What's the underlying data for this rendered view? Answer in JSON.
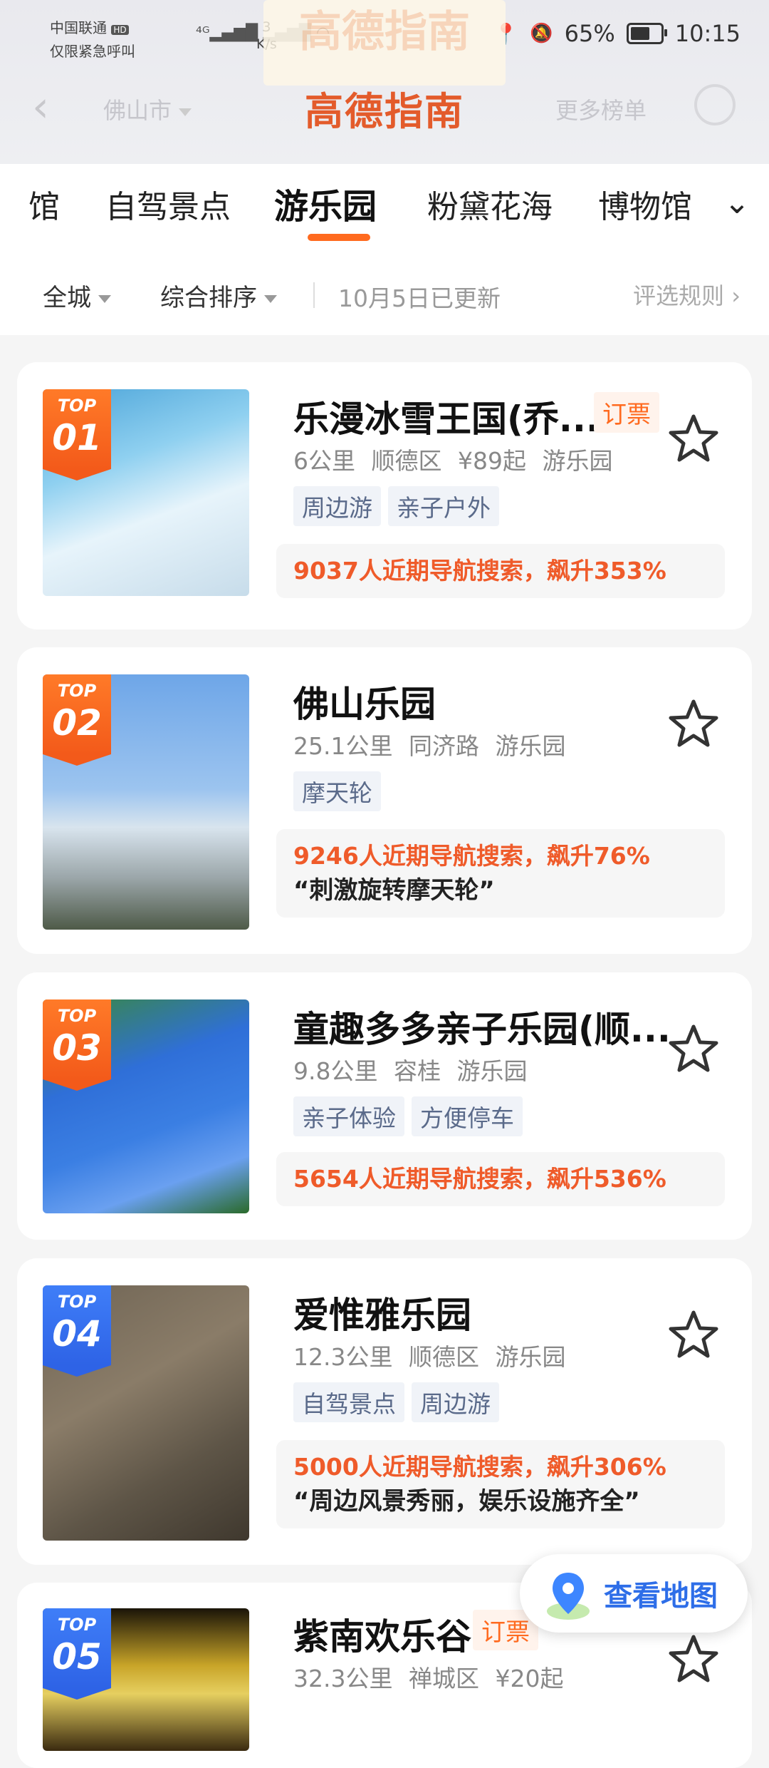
{
  "status_bar": {
    "carrier_line1": "中国联通",
    "carrier_hd": "HD",
    "carrier_line2": "仅限紧急呼叫",
    "net_value": "3",
    "net_unit": "K/s",
    "battery": "65%",
    "battery_level": 0.65,
    "time": "10:15"
  },
  "nav": {
    "city": "佛山市",
    "more": "更多榜单",
    "logo_ghost": "高德指南",
    "logo": "高德指南"
  },
  "tabs": [
    "馆",
    "自驾景点",
    "游乐园",
    "粉黛花海",
    "博物馆"
  ],
  "active_tab_index": 2,
  "filters": {
    "area": "全城",
    "sort": "综合排序",
    "updated": "10月5日已更新",
    "rules": "评选规则"
  },
  "items": [
    {
      "rank_label": "TOP",
      "rank": "01",
      "badge_color": "#f35a1a",
      "title": "乐漫冰雪王国(乔...",
      "ticket": "订票",
      "meta": "6公里  顺德区  ¥89起  游乐园",
      "tags": [
        "周边游",
        "亲子户外"
      ],
      "stat": "9037人近期导航搜索，飙升353%",
      "quote": ""
    },
    {
      "rank_label": "TOP",
      "rank": "02",
      "badge_color": "#f35a1a",
      "title": "佛山乐园",
      "ticket": "",
      "meta": "25.1公里  同济路  游乐园",
      "tags": [
        "摩天轮"
      ],
      "stat": "9246人近期导航搜索，飙升76%",
      "quote": "“刺激旋转摩天轮”"
    },
    {
      "rank_label": "TOP",
      "rank": "03",
      "badge_color": "#f35a1a",
      "title": "童趣多多亲子乐园(顺...",
      "ticket": "",
      "meta": "9.8公里  容桂  游乐园",
      "tags": [
        "亲子体验",
        "方便停车"
      ],
      "stat": "5654人近期导航搜索，飙升536%",
      "quote": ""
    },
    {
      "rank_label": "TOP",
      "rank": "04",
      "badge_color": "#2e63e6",
      "title": "爱惟雅乐园",
      "ticket": "",
      "meta": "12.3公里  顺德区  游乐园",
      "tags": [
        "自驾景点",
        "周边游"
      ],
      "stat": "5000人近期导航搜索，飙升306%",
      "quote": "“周边风景秀丽，娱乐设施齐全”"
    },
    {
      "rank_label": "TOP",
      "rank": "05",
      "badge_color": "#2e63e6",
      "title": "紫南欢乐谷",
      "ticket": "订票",
      "meta": "32.3公里  禅城区  ¥20起",
      "tags": [],
      "stat": "",
      "quote": ""
    }
  ],
  "map_button": "查看地图",
  "colors": {
    "accent": "#ff6a1f",
    "stat_text": "#ef5b2a",
    "map_blue": "#2e6ee8"
  }
}
